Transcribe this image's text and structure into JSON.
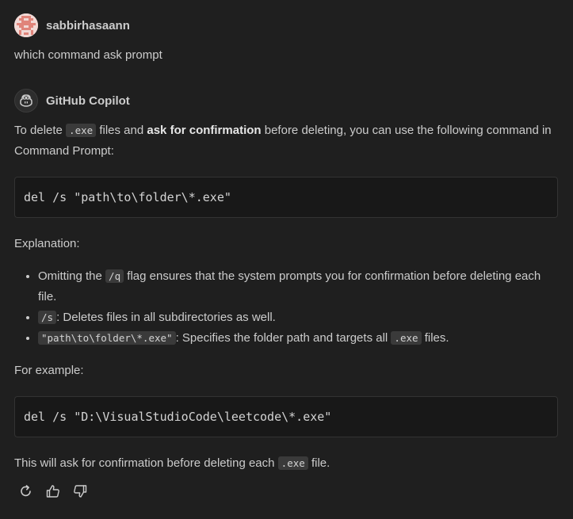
{
  "user": {
    "name": "sabbirhasaann",
    "message": "which command ask prompt"
  },
  "bot": {
    "name": "GitHub Copilot",
    "intro": {
      "t1": "To delete ",
      "code1": ".exe",
      "t2": " files and ",
      "bold": "ask for confirmation",
      "t3": " before deleting, you can use the following command in Command Prompt:"
    },
    "code_block_1": "del /s \"path\\to\\folder\\*.exe\"",
    "explanation_label": "Explanation:",
    "bullets": {
      "b1_t1": "Omitting the ",
      "b1_code": "/q",
      "b1_t2": " flag ensures that the system prompts you for confirmation before deleting each file.",
      "b2_code": "/s",
      "b2_t": ": Deletes files in all subdirectories as well.",
      "b3_code": "\"path\\to\\folder\\*.exe\"",
      "b3_t1": ": Specifies the folder path and targets all ",
      "b3_code2": ".exe",
      "b3_t2": " files."
    },
    "example_label": "For example:",
    "code_block_2": "del /s \"D:\\VisualStudioCode\\leetcode\\*.exe\"",
    "closing": {
      "t1": "This will ask for confirmation before deleting each ",
      "code": ".exe",
      "t2": " file."
    }
  },
  "actions": {
    "icons": [
      "retry-icon",
      "thumbs-up-icon",
      "thumbs-down-icon"
    ]
  },
  "colors": {
    "background": "#1f1f1f",
    "text": "#cccccc",
    "code_bg": "#181818",
    "inline_code_bg": "#3a3a3a",
    "avatar_accent": "#e0847a"
  }
}
